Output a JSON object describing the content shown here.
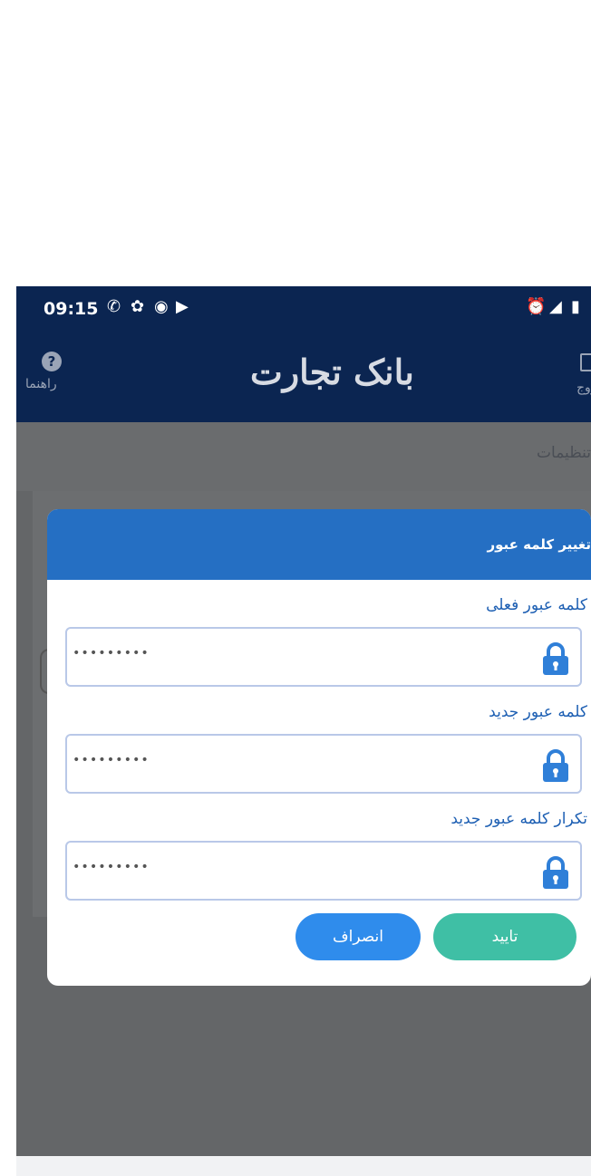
{
  "status_bar": {
    "time": "09:15",
    "left_icons": [
      "whatsapp-icon",
      "pinwheel-icon",
      "telegram-icon",
      "play-icon"
    ],
    "right_icons": [
      "alarm-icon",
      "signal-icon",
      "battery-icon"
    ]
  },
  "app_bar": {
    "help_label": "راهنما",
    "logo_text": "بانک تجارت",
    "exit_label": "خروج"
  },
  "background": {
    "section_title": "تنظیمات"
  },
  "dialog": {
    "title": "تغییر کلمه عبور",
    "fields": [
      {
        "label": "کلمه عبور فعلی",
        "value": "•••••••••"
      },
      {
        "label": "کلمه عبور جدید",
        "value": "•••••••••"
      },
      {
        "label": "تکرار کلمه عبور جدید",
        "value": "•••••••••"
      }
    ],
    "confirm_label": "تایید",
    "cancel_label": "انصراف"
  },
  "colors": {
    "app_bar": "#0b2551",
    "dialog_header": "#256fc3",
    "confirm": "#3fbfa5",
    "cancel": "#2f8cec",
    "overlay": "#646668",
    "field_label": "#1d5fb3"
  }
}
